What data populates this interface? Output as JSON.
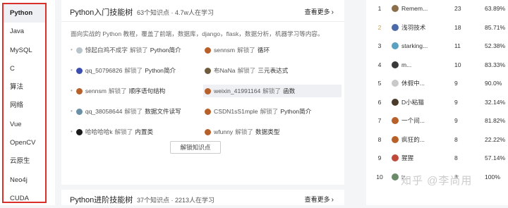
{
  "sidebar": {
    "items": [
      "Python",
      "Java",
      "MySQL",
      "C",
      "算法",
      "网络",
      "Vue",
      "OpenCV",
      "云原生",
      "Neo4j",
      "CUDA"
    ],
    "active": "Python"
  },
  "card1": {
    "title": "Python入门技能树",
    "meta": "63个知识点 · 4.7w人在学习",
    "see_more": "查看更多",
    "desc": "面向实战的 Python 教程，覆盖了前端，数据库，django，flask，数据分析，机器学习等内容。",
    "unlock": "解锁知识点",
    "activities": [
      {
        "name": "惊起白鸡不成字",
        "action": "解锁了",
        "target": "Python简介",
        "color": "#b8c4c9"
      },
      {
        "name": "sennsm",
        "action": "解锁了",
        "target": "循环",
        "color": "#b8602a"
      },
      {
        "name": "qq_50796826",
        "action": "解锁了",
        "target": "Python简介",
        "color": "#3b4fb0"
      },
      {
        "name": "布NaNa",
        "action": "解锁了",
        "target": "三元表达式",
        "color": "#6e5a3c"
      },
      {
        "name": "sennsm",
        "action": "解锁了",
        "target": "顺序语句结构",
        "color": "#b8602a"
      },
      {
        "name": "weixin_41991164",
        "action": "解锁了",
        "target": "函数",
        "color": "#b8602a",
        "highlight": true
      },
      {
        "name": "qq_38058644",
        "action": "解锁了",
        "target": "数据文件读写",
        "color": "#6a90a8"
      },
      {
        "name": "CSDN1sS1mple",
        "action": "解锁了",
        "target": "Python简介",
        "color": "#b8602a"
      },
      {
        "name": "哈哈哈哈k",
        "action": "解锁了",
        "target": "内置类",
        "color": "#1a1a1a"
      },
      {
        "name": "wfunny",
        "action": "解锁了",
        "target": "数据类型",
        "color": "#b8602a"
      }
    ]
  },
  "card2": {
    "title": "Python进阶技能树",
    "meta": "37个知识点 · 2213人在学习",
    "see_more": "查看更多"
  },
  "ranking": [
    {
      "rank": "1",
      "name": "Remem...",
      "count": "23",
      "pct": "63.89%",
      "color": "#8a6e4a"
    },
    {
      "rank": "2",
      "name": "浅羽技术",
      "count": "18",
      "pct": "85.71%",
      "color": "#4a6aa8"
    },
    {
      "rank": "3",
      "name": "starking...",
      "count": "11",
      "pct": "52.38%",
      "color": "#5aa0c0"
    },
    {
      "rank": "4",
      "name": "m...",
      "count": "10",
      "pct": "83.33%",
      "color": "#3a3a3a"
    },
    {
      "rank": "5",
      "name": "休假中...",
      "count": "9",
      "pct": "90.0%",
      "color": "#c9c9c9"
    },
    {
      "rank": "6",
      "name": "D小粘猫",
      "count": "9",
      "pct": "32.14%",
      "color": "#4a3a2a"
    },
    {
      "rank": "7",
      "name": "一个间...",
      "count": "9",
      "pct": "81.82%",
      "color": "#b8602a"
    },
    {
      "rank": "8",
      "name": "疯狂的...",
      "count": "8",
      "pct": "22.22%",
      "color": "#b8602a"
    },
    {
      "rank": "9",
      "name": "猩猩",
      "count": "8",
      "pct": "57.14%",
      "color": "#c04a3a"
    },
    {
      "rank": "10",
      "name": "tr...",
      "count": "8",
      "pct": "100%",
      "color": "#6a8a6a"
    }
  ],
  "watermark": "知乎 @李尚用"
}
